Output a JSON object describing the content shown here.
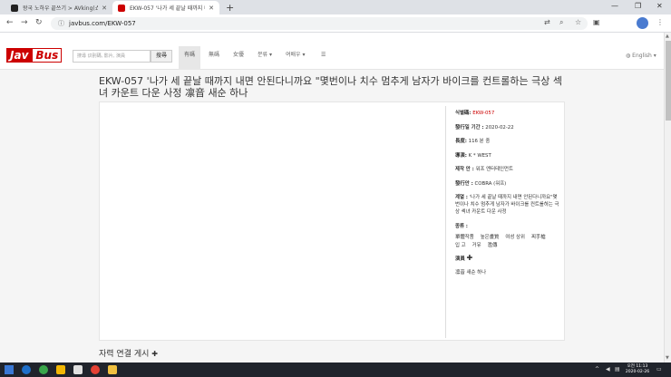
{
  "browser": {
    "tabs": [
      {
        "label": "왕국 노하우 끝쓰기 > AVking(쇼..."
      },
      {
        "label": "EKW-057 '나가 세 끝날 때까지 내..."
      }
    ],
    "url": "javbus.com/EKW-057"
  },
  "site": {
    "logo_left": "Jav",
    "logo_right": "Bus",
    "search_placeholder": "搜尋 识别碼, 影片, 演員",
    "search_button": "搜尋",
    "nav": [
      {
        "label": "有碼"
      },
      {
        "label": "無碼"
      },
      {
        "label": "女優"
      },
      {
        "label": "분류 ▾"
      },
      {
        "label": "여배우 ▾"
      },
      {
        "label": "☰"
      }
    ],
    "language": "English ▾"
  },
  "movie": {
    "title": "EKW-057 '나가 세 끝날 때까지 내면 안된다니까요 \"몇번이나 치수 멈추게 남자가 바이크를 컨트롤하는 극상 섹녀 카운트 다운 사정 凛音 새순 하나",
    "id_label": "식별碼:",
    "id_value": "EKW-057",
    "date_label": "發行일 기간 :",
    "date_value": "2020-02-22",
    "length_label": "長度:",
    "length_value": "116 분 중",
    "maker_label": "導演:",
    "maker_value": "K * WEST",
    "studio_label": "제작 안 :",
    "studio_value": "워프 엔터테인먼트",
    "publisher_label": "發行안 :",
    "publisher_value": "COBRA (워프)",
    "series_label": "계열 :",
    "series_value": "'나가 세 끝날 때까지 내면 안된다니까요\"몇번이나 치수 멈추게 남자가 바이크를 컨트롤하는 극상 섹녀 카운트 다운 사정",
    "genre_label": "종류 :",
    "genres": [
      "單體작품",
      "높은畫質",
      "여성 상위",
      "찌手槍",
      "입 고",
      "거유",
      "濫傳"
    ],
    "actors_label": "演員",
    "actor": "凛音 새순 하나"
  },
  "bottom": {
    "header": "자력 연결 게시"
  },
  "taskbar": {
    "time": "오전 11:13",
    "date": "2020-02-26"
  }
}
